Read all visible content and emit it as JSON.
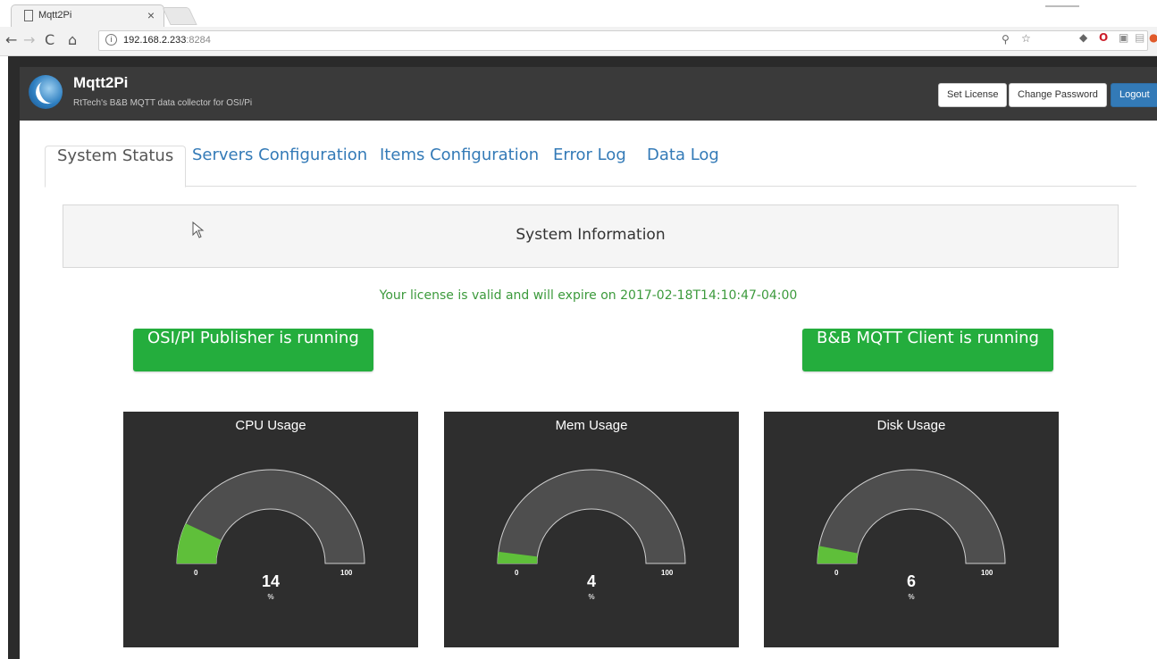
{
  "browser": {
    "tab_title": "Mqtt2Pi",
    "tab_close": "×",
    "url_host": "192.168.2.233",
    "url_port": ":8284",
    "info_glyph": "i"
  },
  "header": {
    "brand_name": "Mqtt2Pi",
    "brand_subtitle": "RtTech's B&B MQTT data collector for OSI/Pi",
    "buttons": {
      "set_license": "Set License",
      "change_password": "Change Password",
      "logout": "Logout"
    }
  },
  "tabs": [
    {
      "label": "System Status",
      "active": true
    },
    {
      "label": "Servers Configuration"
    },
    {
      "label": "Items Configuration"
    },
    {
      "label": "Error Log"
    },
    {
      "label": "Data Log"
    }
  ],
  "system_info_title": "System Information",
  "license_message": "Your license is valid and will expire on 2017-02-18T14:10:47-04:00",
  "status": {
    "publisher": "OSI/PI Publisher is running",
    "client": "B&B MQTT Client is running"
  },
  "gauges": [
    {
      "title": "CPU Usage",
      "value": 14,
      "min": 0,
      "max": 100,
      "unit": "%"
    },
    {
      "title": "Mem Usage",
      "value": 4,
      "min": 0,
      "max": 100,
      "unit": "%"
    },
    {
      "title": "Disk Usage",
      "value": 6,
      "min": 0,
      "max": 100,
      "unit": "%"
    }
  ],
  "colors": {
    "gauge_fill": "#5fbf3a",
    "gauge_track": "#4e4e4e",
    "running_green": "#24ad3d",
    "link_blue": "#337ab7",
    "license_green": "#3c9a3c"
  }
}
